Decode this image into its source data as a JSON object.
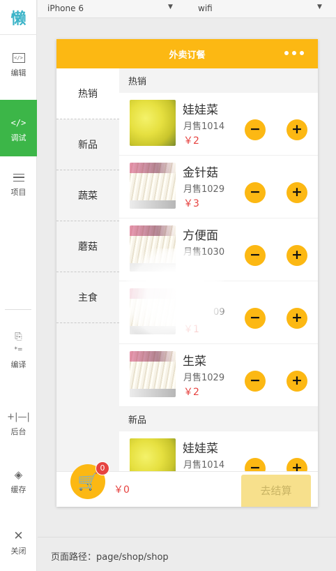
{
  "rail": {
    "logo": "懒",
    "items": [
      {
        "label": "编辑",
        "icon": "code-window-icon"
      },
      {
        "label": "调试",
        "icon": "code-icon"
      },
      {
        "label": "项目",
        "icon": "menu-icon"
      },
      {
        "label": "编译",
        "icon": "compile-icon"
      },
      {
        "label": "后台",
        "icon": "backend-icon"
      },
      {
        "label": "缓存",
        "icon": "layers-icon"
      },
      {
        "label": "关闭",
        "icon": "close-icon"
      }
    ]
  },
  "topbar": {
    "device": "iPhone 6",
    "network": "wifi"
  },
  "app": {
    "title": "外卖订餐",
    "categories": [
      "热销",
      "新品",
      "蔬菜",
      "蘑菇",
      "主食"
    ],
    "sections": [
      {
        "title": "热销",
        "items": [
          {
            "name": "娃娃菜",
            "sales": "月售1014",
            "price": "￥2",
            "img": "cabbage"
          },
          {
            "name": "金针菇",
            "sales": "月售1029",
            "price": "￥3",
            "img": "mushroom"
          },
          {
            "name": "方便面",
            "sales": "月售1030",
            "price": "",
            "img": "mushroom"
          },
          {
            "name": "",
            "sales": "09",
            "price": "￥1",
            "img": "mushroom"
          },
          {
            "name": "生菜",
            "sales": "月售1029",
            "price": "￥2",
            "img": "mushroom"
          }
        ]
      },
      {
        "title": "新品",
        "items": [
          {
            "name": "娃娃菜",
            "sales": "月售1014",
            "price": "",
            "img": "cabbage"
          }
        ]
      }
    ],
    "cart": {
      "count": "0",
      "total": "￥0",
      "checkout": "去结算"
    },
    "colors": {
      "primary": "#fcb813",
      "price": "#e64340",
      "debug_active": "#3cb648"
    }
  },
  "footer": {
    "path": "页面路径：page/shop/shop"
  }
}
